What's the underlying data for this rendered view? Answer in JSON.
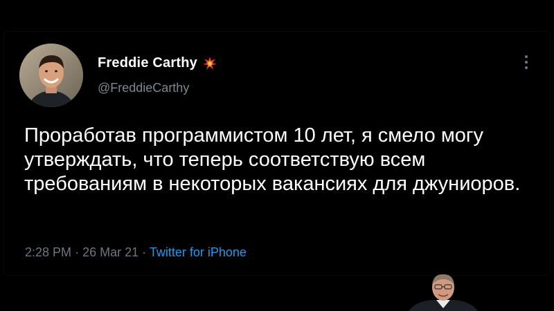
{
  "tweet": {
    "author_name": "Freddie Carthy",
    "handle": "@FreddieCarthy",
    "name_emoji_icon": "collision-burst-icon",
    "menu_icon": "vertical-ellipsis-icon",
    "text": "Проработав программистом 10 лет, я смело могу утверждать, что теперь соответствую всем требованиям в некоторых вакансиях для джуниоров.",
    "time": "2:28 PM",
    "separator": "·",
    "date": "26 Mar 21",
    "source": "Twitter for iPhone"
  },
  "colors": {
    "background": "#000000",
    "text": "#ffffff",
    "secondary_text": "#6f767e",
    "link": "#1d9bf0"
  },
  "overlay": {
    "meme_face_icon": "smiling-man-face-icon"
  }
}
